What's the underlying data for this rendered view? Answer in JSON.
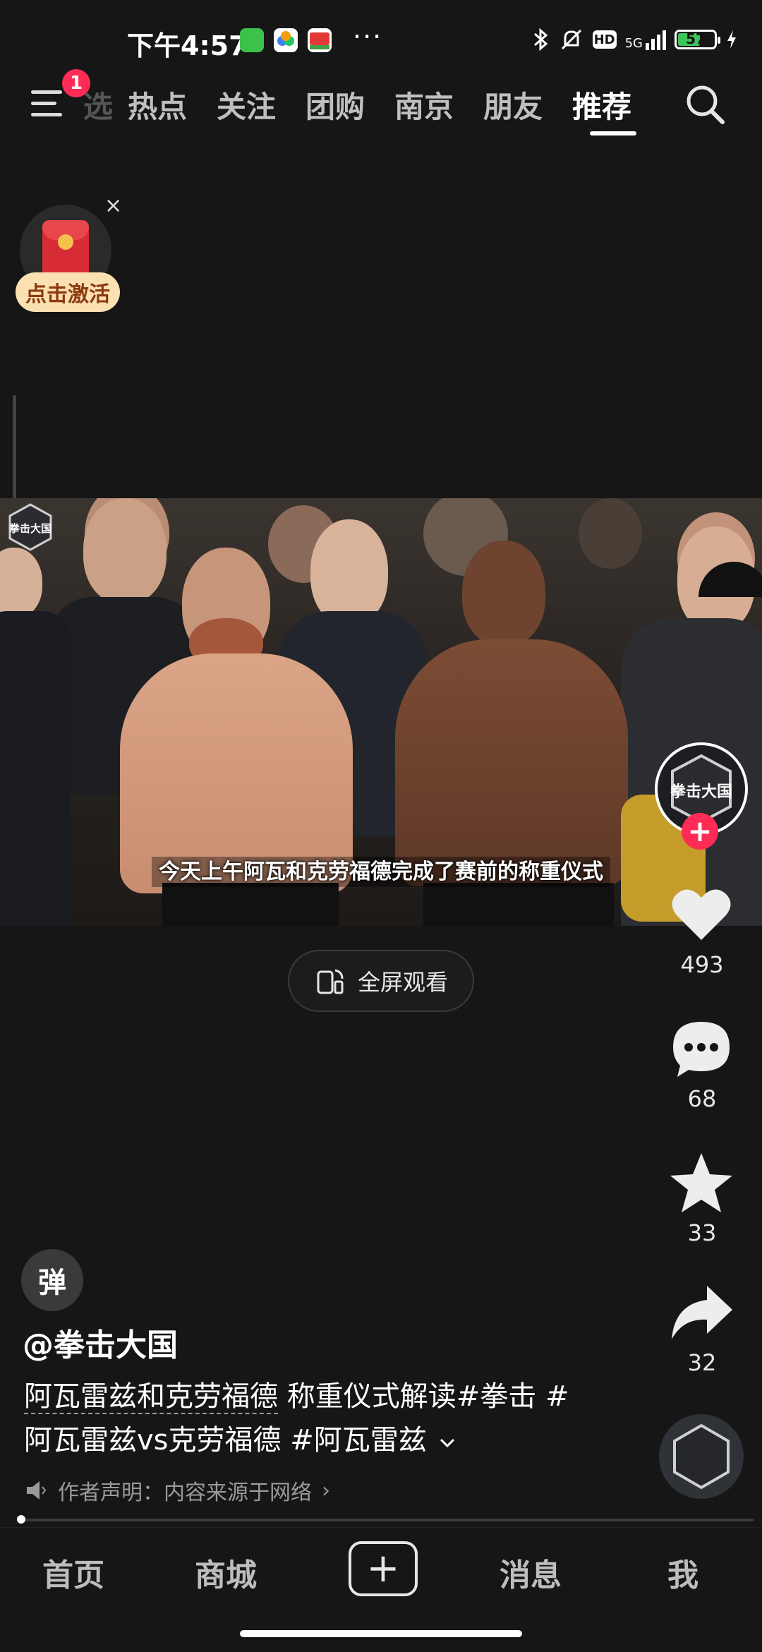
{
  "status_bar": {
    "time": "下午4:57",
    "network": "5G",
    "hd": "HD",
    "battery": "57",
    "more": "···"
  },
  "top_nav": {
    "badge": "1",
    "tabs": [
      "热点",
      "关注",
      "团购",
      "南京",
      "朋友",
      "推荐"
    ],
    "partial_tab": "选",
    "active_tab": "推荐"
  },
  "red_packet": {
    "button": "点击激活",
    "close": "×"
  },
  "video": {
    "subtitle": "今天上午阿瓦和克劳福德完成了赛前的称重仪式",
    "watermark": "拳击大国"
  },
  "fullscreen_button": "全屏观看",
  "rail": {
    "likes": "493",
    "comments": "68",
    "favorites": "33",
    "shares": "32",
    "avatar_text": "拳击大国",
    "follow": "+"
  },
  "caption": {
    "danmu": "弹",
    "author": "@拳击大国",
    "desc_line1_link": "阿瓦雷兹和克劳福德",
    "desc_line1_rest": " 称重仪式解读#拳击 #",
    "desc_line2": "阿瓦雷兹vs克劳福德 #阿瓦雷兹",
    "declaration": "作者声明：内容来源于网络",
    "decl_chevron": "›"
  },
  "bottom_nav": {
    "home": "首页",
    "mall": "商城",
    "messages": "消息",
    "me": "我"
  },
  "colors": {
    "accent": "#fe2c55",
    "background": "#161616",
    "battery_fill": "#3ec45b"
  }
}
